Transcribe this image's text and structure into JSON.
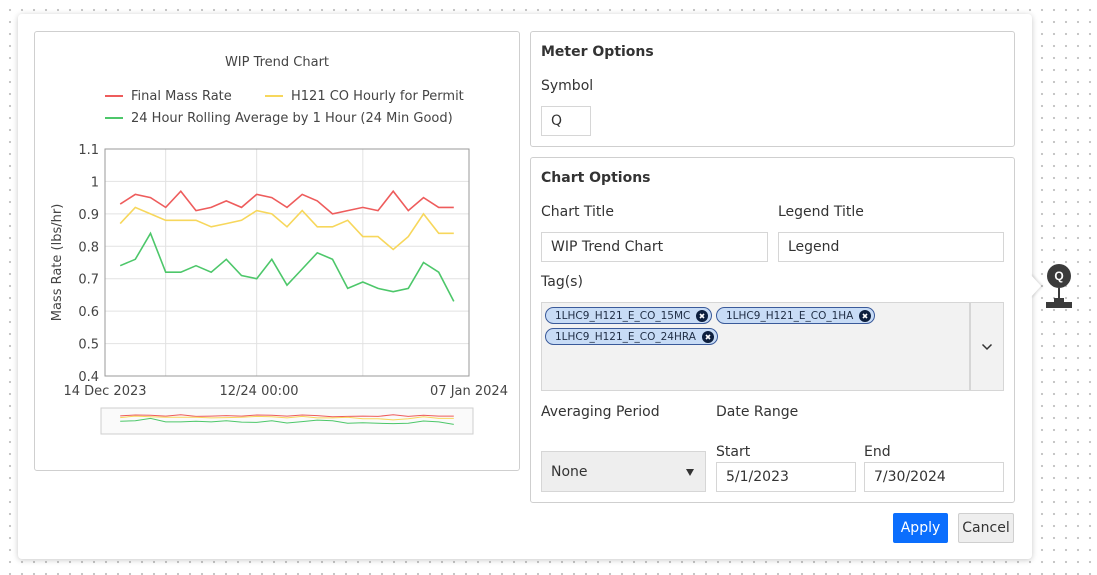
{
  "meter_options": {
    "title": "Meter Options",
    "symbol_label": "Symbol",
    "symbol_value": "Q"
  },
  "chart_options": {
    "title": "Chart Options",
    "chart_title_label": "Chart Title",
    "chart_title_value": "WIP Trend Chart",
    "legend_title_label": "Legend Title",
    "legend_title_value": "Legend",
    "tags_label": "Tag(s)",
    "tags": [
      "1LHC9_H121_E_CO_15MC",
      "1LHC9_H121_E_CO_1HA",
      "1LHC9_H121_E_CO_24HRA"
    ],
    "averaging_period_label": "Averaging Period",
    "averaging_period_value": "None",
    "date_range_label": "Date Range",
    "start_label": "Start",
    "start_value": "5/1/2023",
    "end_label": "End",
    "end_value": "7/30/2024"
  },
  "buttons": {
    "apply": "Apply",
    "cancel": "Cancel"
  },
  "node": {
    "symbol": "Q"
  },
  "colors": {
    "final_mass_rate": "#ee5c5c",
    "h121_co_hourly": "#f7d75c",
    "rolling_avg": "#4dc76a",
    "apply_button": "#0b6efd"
  },
  "chart_data": {
    "type": "line",
    "title": "WIP Trend Chart",
    "ylabel": "Mass Rate (lbs/hr)",
    "ylim": [
      0.4,
      1.1
    ],
    "yticks": [
      "1.1",
      "1",
      "0.9",
      "0.8",
      "0.7",
      "0.6",
      "0.5",
      "0.4"
    ],
    "xticks": [
      "14 Dec 2023",
      "12/24 00:00",
      "07 Jan 2024"
    ],
    "x_range": [
      "2023-12-14",
      "2024-01-07"
    ],
    "grid": true,
    "legend_position": "top",
    "range_slider": true,
    "x": [
      "2023-12-15",
      "2023-12-16",
      "2023-12-17",
      "2023-12-18",
      "2023-12-19",
      "2023-12-20",
      "2023-12-21",
      "2023-12-22",
      "2023-12-23",
      "2023-12-24",
      "2023-12-25",
      "2023-12-26",
      "2023-12-27",
      "2023-12-28",
      "2023-12-29",
      "2023-12-30",
      "2023-12-31",
      "2024-01-01",
      "2024-01-02",
      "2024-01-03",
      "2024-01-04",
      "2024-01-05",
      "2024-01-06"
    ],
    "series": [
      {
        "name": "Final Mass Rate",
        "color": "#ee5c5c",
        "values": [
          0.93,
          0.96,
          0.95,
          0.92,
          0.97,
          0.91,
          0.92,
          0.94,
          0.92,
          0.96,
          0.95,
          0.92,
          0.96,
          0.94,
          0.9,
          0.91,
          0.92,
          0.91,
          0.97,
          0.91,
          0.95,
          0.92,
          0.92
        ]
      },
      {
        "name": "H121 CO Hourly for Permit",
        "color": "#f7d75c",
        "values": [
          0.87,
          0.92,
          0.9,
          0.88,
          0.88,
          0.88,
          0.86,
          0.87,
          0.88,
          0.91,
          0.9,
          0.86,
          0.91,
          0.86,
          0.86,
          0.88,
          0.83,
          0.83,
          0.79,
          0.83,
          0.9,
          0.84,
          0.84
        ]
      },
      {
        "name": "24 Hour Rolling Average by 1 Hour (24 Min Good)",
        "color": "#4dc76a",
        "values": [
          0.74,
          0.76,
          0.84,
          0.72,
          0.72,
          0.74,
          0.72,
          0.76,
          0.71,
          0.7,
          0.76,
          0.68,
          0.73,
          0.78,
          0.76,
          0.67,
          0.69,
          0.67,
          0.66,
          0.67,
          0.75,
          0.72,
          0.63
        ]
      }
    ]
  }
}
